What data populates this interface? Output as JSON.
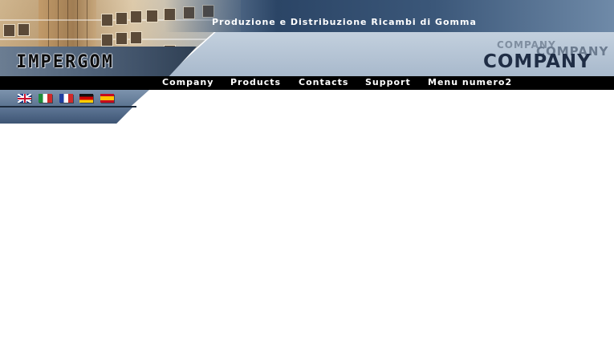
{
  "header": {
    "logo_text": "IMPERGOM",
    "tagline": "Produzione e Distribuzione Ricambi di Gomma",
    "company_titles": [
      "COMPANY",
      "COMPANY",
      "COMPANY"
    ]
  },
  "nav": {
    "items": [
      {
        "label": "Company"
      },
      {
        "label": "Products"
      },
      {
        "label": "Contacts"
      },
      {
        "label": "Support"
      },
      {
        "label": "Menu numero2"
      }
    ]
  },
  "languages": [
    {
      "icon": "uk-flag-icon"
    },
    {
      "icon": "italy-flag-icon"
    },
    {
      "icon": "france-flag-icon"
    },
    {
      "icon": "germany-flag-icon"
    },
    {
      "icon": "spain-flag-icon"
    }
  ],
  "colors": {
    "nav_background": "#000000",
    "company_title": "#1f2d45",
    "panel": "#a8b9cc"
  }
}
